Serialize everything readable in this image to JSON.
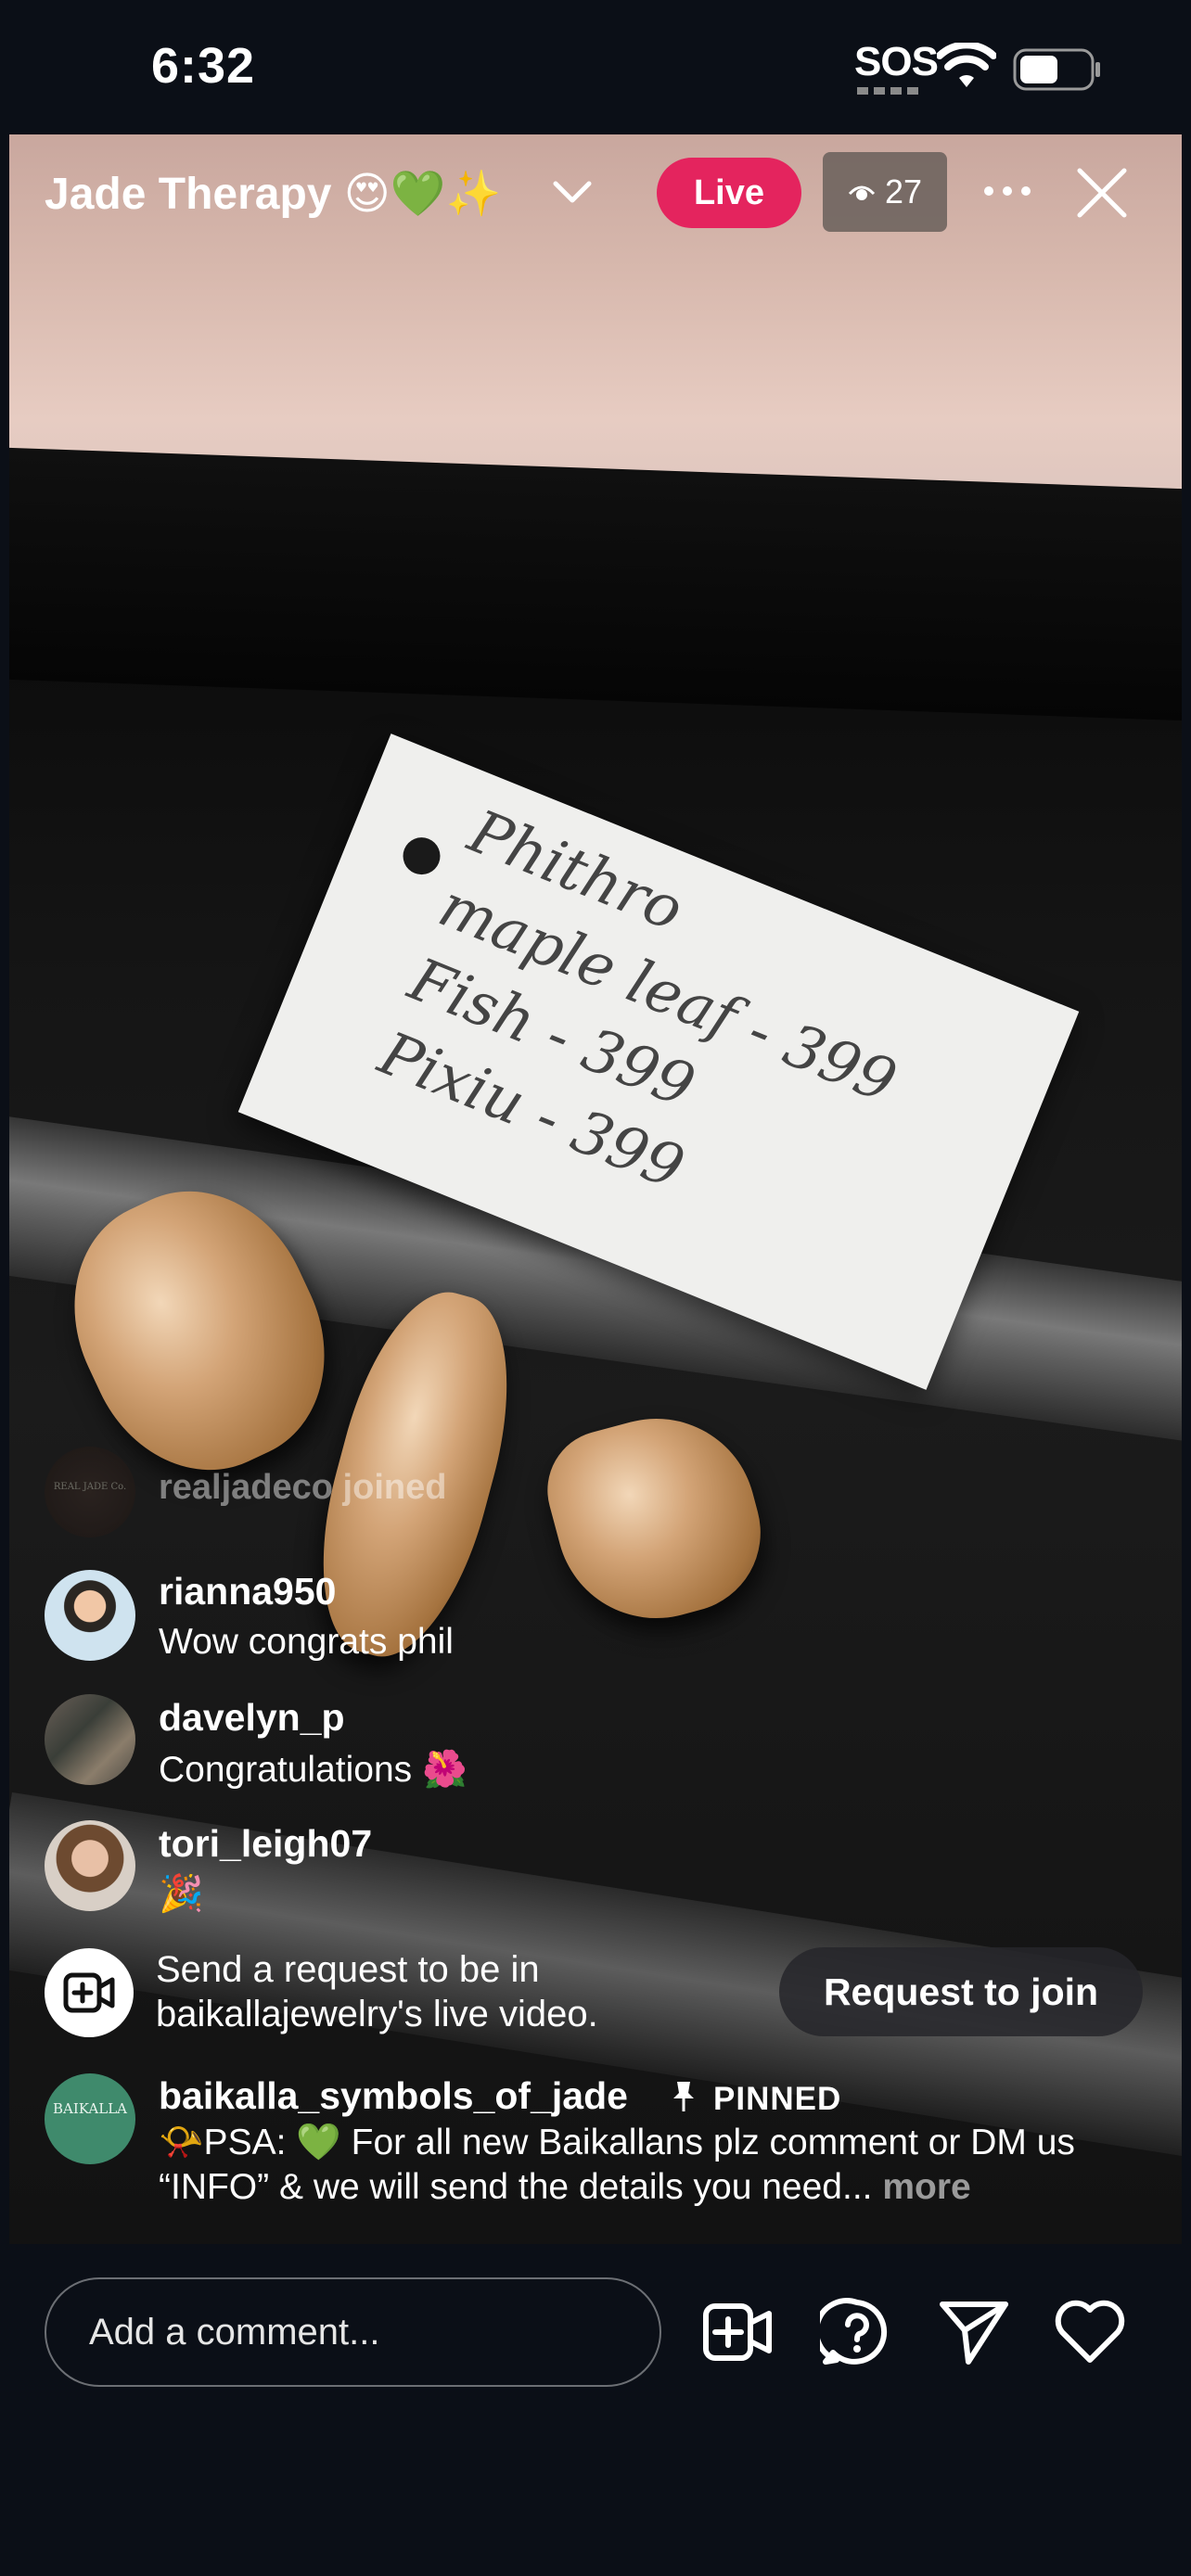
{
  "status_bar": {
    "time": "6:32",
    "sos": "SOS",
    "icons": [
      "wifi-icon",
      "battery-icon"
    ]
  },
  "live": {
    "title": "Jade Therapy 😍💚✨",
    "badge": "Live",
    "viewer_count": "27"
  },
  "video": {
    "tag_lines": [
      "Phithro",
      "maple leaf - 399",
      "Fish  -  399",
      "Pixiu  -  399"
    ]
  },
  "comments": {
    "join_notice": "realjadeco joined",
    "realjadeco_avatar_text": "REAL JADE Co.",
    "items": [
      {
        "user": "rianna950",
        "text": "Wow congrats phil"
      },
      {
        "user": "davelyn_p",
        "text": "Congratulations 🌺"
      },
      {
        "user": "tori_leigh07",
        "text": "🎉"
      }
    ]
  },
  "request": {
    "text": "Send a request to be in baikallajewelry's live video.",
    "button": "Request to join"
  },
  "pinned": {
    "user": "baikalla_symbols_of_jade",
    "label": "PINNED",
    "text": "📯PSA: 💚 For all new Baikallans plz comment or DM us “INFO” & we will send the details you need... ",
    "more": "more",
    "avatar_text": "BAIKALLA"
  },
  "bottom_bar": {
    "comment_placeholder": "Add a comment...",
    "icons": [
      "add-video-icon",
      "question-icon",
      "send-icon",
      "heart-icon"
    ]
  },
  "colors": {
    "live_badge": "#e4245e",
    "background": "#0b0f17"
  }
}
